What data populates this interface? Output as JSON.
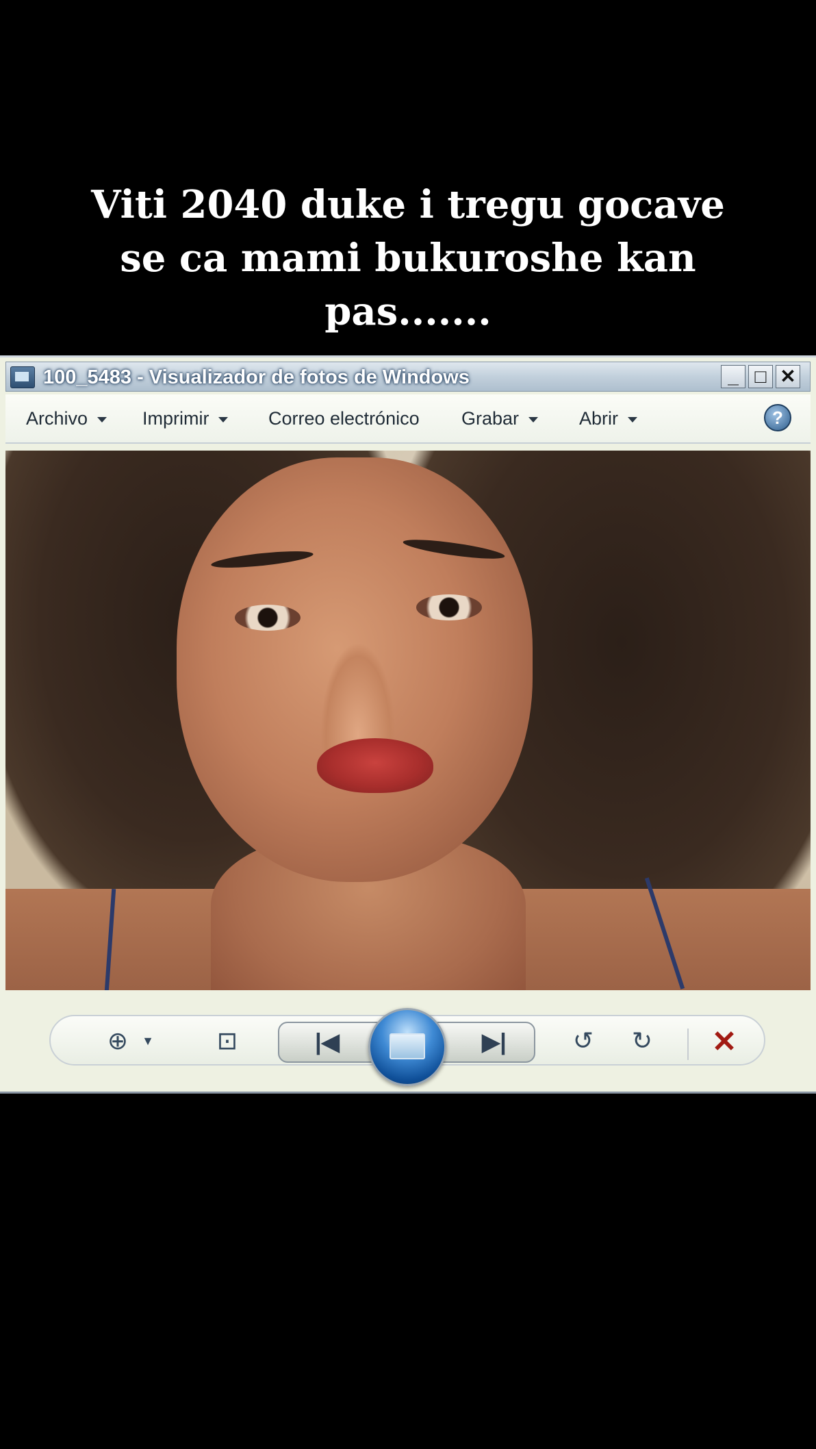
{
  "caption": {
    "line1": "Viti 2040 duke i tregu gocave",
    "line2": "se ca mami bukuroshe kan",
    "line3": "pas......."
  },
  "window": {
    "title": "100_5483 - Visualizador de fotos de Windows",
    "controls": {
      "minimize": "_",
      "maximize": "□",
      "close": "✕"
    }
  },
  "menu": {
    "items": [
      {
        "label": "Archivo",
        "dropdown": true
      },
      {
        "label": "Imprimir",
        "dropdown": true
      },
      {
        "label": "Correo electrónico",
        "dropdown": false
      },
      {
        "label": "Grabar",
        "dropdown": true
      },
      {
        "label": "Abrir",
        "dropdown": true
      }
    ],
    "help": "?"
  },
  "toolbar": {
    "zoom_icon": "magnifier-plus-icon",
    "fit_icon": "actual-size-icon",
    "previous_icon": "previous-icon",
    "slideshow_icon": "slideshow-icon",
    "next_icon": "next-icon",
    "rotate_ccw_icon": "rotate-counterclockwise-icon",
    "rotate_cw_icon": "rotate-clockwise-icon",
    "delete_icon": "delete-icon"
  },
  "colors": {
    "background": "#000000",
    "window_bg": "#eef1e2",
    "delete_red": "#a11a12",
    "slideshow_blue": "#1f6bbf"
  }
}
